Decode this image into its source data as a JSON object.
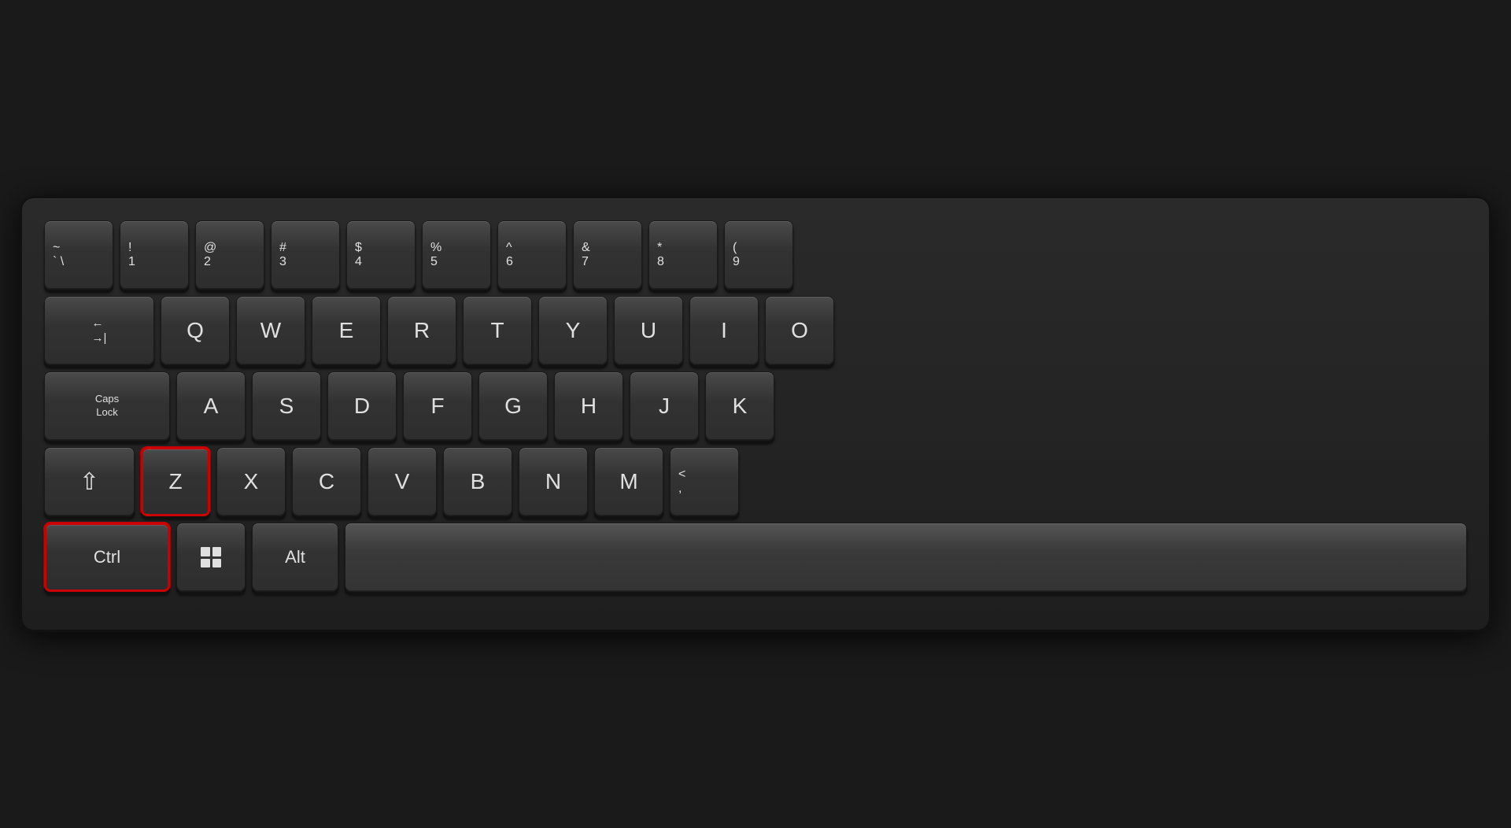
{
  "keyboard": {
    "rows": [
      {
        "id": "row1",
        "keys": [
          {
            "id": "tilde",
            "top": "~",
            "bottom": "`",
            "display": "symbol",
            "label": "` ~"
          },
          {
            "id": "1",
            "top": "!",
            "bottom": "1",
            "display": "numrow"
          },
          {
            "id": "2",
            "top": "@",
            "bottom": "2",
            "display": "numrow"
          },
          {
            "id": "3",
            "top": "#",
            "bottom": "3",
            "display": "numrow"
          },
          {
            "id": "4",
            "top": "$",
            "bottom": "4",
            "display": "numrow"
          },
          {
            "id": "5",
            "top": "%",
            "bottom": "5",
            "display": "numrow"
          },
          {
            "id": "6",
            "top": "^",
            "bottom": "6",
            "display": "numrow"
          },
          {
            "id": "7",
            "top": "&",
            "bottom": "7",
            "display": "numrow"
          },
          {
            "id": "8",
            "top": "*",
            "bottom": "8",
            "display": "numrow"
          },
          {
            "id": "9",
            "top": "(",
            "bottom": "9",
            "display": "numrow"
          }
        ]
      },
      {
        "id": "row2",
        "keys": [
          {
            "id": "tab",
            "label": "Tab",
            "display": "tab"
          },
          {
            "id": "q",
            "label": "Q"
          },
          {
            "id": "w",
            "label": "W"
          },
          {
            "id": "e",
            "label": "E"
          },
          {
            "id": "r",
            "label": "R"
          },
          {
            "id": "t",
            "label": "T"
          },
          {
            "id": "y",
            "label": "Y"
          },
          {
            "id": "u",
            "label": "U"
          },
          {
            "id": "i",
            "label": "I"
          },
          {
            "id": "o",
            "label": "O"
          }
        ]
      },
      {
        "id": "row3",
        "keys": [
          {
            "id": "caps",
            "label": "Caps Lock",
            "display": "caps"
          },
          {
            "id": "a",
            "label": "A"
          },
          {
            "id": "s",
            "label": "S"
          },
          {
            "id": "d",
            "label": "D"
          },
          {
            "id": "f",
            "label": "F"
          },
          {
            "id": "g",
            "label": "G"
          },
          {
            "id": "h",
            "label": "H"
          },
          {
            "id": "j",
            "label": "J"
          },
          {
            "id": "k",
            "label": "K"
          }
        ]
      },
      {
        "id": "row4",
        "keys": [
          {
            "id": "shift-left",
            "label": "⇧",
            "display": "shift"
          },
          {
            "id": "z",
            "label": "Z",
            "highlighted": true
          },
          {
            "id": "x",
            "label": "X"
          },
          {
            "id": "c",
            "label": "C"
          },
          {
            "id": "v",
            "label": "V"
          },
          {
            "id": "b",
            "label": "B"
          },
          {
            "id": "n",
            "label": "N"
          },
          {
            "id": "m",
            "label": "M"
          },
          {
            "id": "comma",
            "top": "<",
            "bottom": ",",
            "display": "symbol"
          }
        ]
      },
      {
        "id": "row5",
        "keys": [
          {
            "id": "ctrl",
            "label": "Ctrl",
            "display": "ctrl",
            "highlighted": true
          },
          {
            "id": "win",
            "label": "win",
            "display": "win"
          },
          {
            "id": "alt",
            "label": "Alt"
          },
          {
            "id": "space",
            "label": "",
            "display": "space"
          }
        ]
      }
    ]
  }
}
